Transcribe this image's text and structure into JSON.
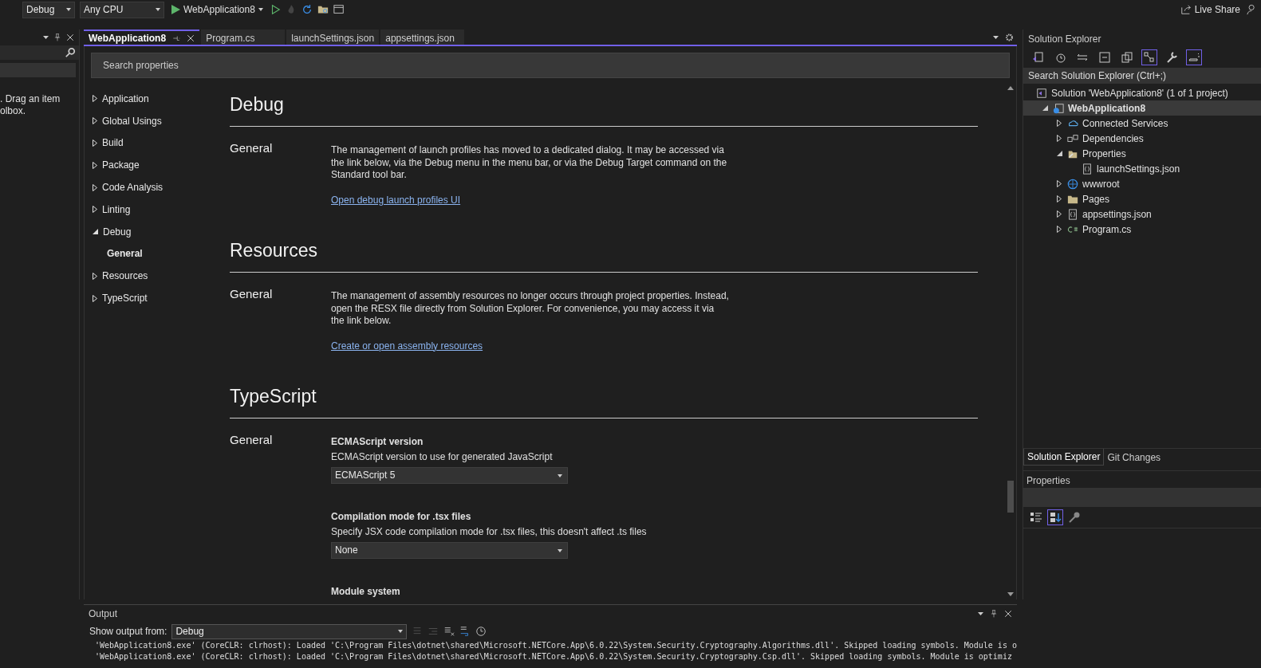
{
  "toolbar": {
    "configuration": "Debug",
    "platform": "Any CPU",
    "start_target": "WebApplication8",
    "live_share": "Live Share"
  },
  "toolbox": {
    "message": ". Drag an item",
    "message_2": "olbox."
  },
  "tabs": [
    {
      "label": "WebApplication8",
      "selected": true
    },
    {
      "label": "Program.cs",
      "selected": false
    },
    {
      "label": "launchSettings.json",
      "selected": false
    },
    {
      "label": "appsettings.json",
      "selected": false
    }
  ],
  "properties_page": {
    "search": {
      "placeholder": "Search properties"
    },
    "nav": [
      {
        "label": "Application",
        "expanded": false,
        "selected": false
      },
      {
        "label": "Global Usings",
        "expanded": false,
        "selected": false
      },
      {
        "label": "Build",
        "expanded": false,
        "selected": false
      },
      {
        "label": "Package",
        "expanded": false,
        "selected": false
      },
      {
        "label": "Code Analysis",
        "expanded": false,
        "selected": false
      },
      {
        "label": "Linting",
        "expanded": false,
        "selected": false
      },
      {
        "label": "Debug",
        "expanded": true,
        "selected": false,
        "children": [
          {
            "label": "General",
            "selected": true
          }
        ]
      },
      {
        "label": "Resources",
        "expanded": false,
        "selected": false
      },
      {
        "label": "TypeScript",
        "expanded": false,
        "selected": false
      }
    ],
    "sections": [
      {
        "title": "Debug",
        "groups": [
          {
            "heading": "General",
            "items": [
              {
                "kind": "text",
                "text": "The management of launch profiles has moved to a dedicated dialog. It may be accessed via the link below, via the Debug menu in the menu bar, or via the Debug Target command on the Standard tool bar.",
                "link": "Open debug launch profiles UI"
              }
            ]
          }
        ]
      },
      {
        "title": "Resources",
        "groups": [
          {
            "heading": "General",
            "items": [
              {
                "kind": "text",
                "text": "The management of assembly resources no longer occurs through project properties. Instead, open the RESX file directly from Solution Explorer. For convenience, you may access it via the link below.",
                "link": "Create or open assembly resources"
              }
            ]
          }
        ]
      },
      {
        "title": "TypeScript",
        "groups": [
          {
            "heading": "General",
            "items": [
              {
                "kind": "dropdown",
                "label": "ECMAScript version",
                "description": "ECMAScript version to use for generated JavaScript",
                "value": "ECMAScript 5"
              },
              {
                "kind": "dropdown",
                "label": "Compilation mode for .tsx files",
                "description": "Specify JSX code compilation mode for .tsx files, this doesn't affect .ts files",
                "value": "None"
              },
              {
                "kind": "heading",
                "label": "Module system"
              }
            ]
          }
        ]
      }
    ]
  },
  "solution_explorer": {
    "title": "Solution Explorer",
    "search": {
      "placeholder": "Search Solution Explorer (Ctrl+;)"
    },
    "tree": [
      {
        "label": "Solution 'WebApplication8' (1 of 1 project)",
        "kind": "solution",
        "selected": false,
        "children": [
          {
            "label": "WebApplication8",
            "kind": "project",
            "expanded": true,
            "selected": true,
            "children": [
              {
                "label": "Connected Services",
                "kind": "services",
                "expanded": false,
                "selected": false
              },
              {
                "label": "Dependencies",
                "kind": "dependencies",
                "expanded": false,
                "selected": false
              },
              {
                "label": "Properties",
                "kind": "properties",
                "expanded": true,
                "selected": false,
                "children": [
                  {
                    "label": "launchSettings.json",
                    "kind": "json",
                    "selected": false
                  }
                ]
              },
              {
                "label": "wwwroot",
                "kind": "web",
                "expanded": false,
                "selected": false
              },
              {
                "label": "Pages",
                "kind": "folder",
                "expanded": false,
                "selected": false
              },
              {
                "label": "appsettings.json",
                "kind": "json",
                "expanded": false,
                "selected": false
              },
              {
                "label": "Program.cs",
                "kind": "csharp",
                "expanded": false,
                "selected": false
              }
            ]
          }
        ]
      }
    ],
    "bottom_tabs": [
      {
        "label": "Solution Explorer",
        "selected": true
      },
      {
        "label": "Git Changes",
        "selected": false
      }
    ]
  },
  "properties_panel": {
    "title": "Properties"
  },
  "output": {
    "title": "Output",
    "source_label": "Show output from:",
    "source": "Debug",
    "lines": [
      "'WebApplication8.exe' (CoreCLR: clrhost): Loaded 'C:\\Program Files\\dotnet\\shared\\Microsoft.NETCore.App\\6.0.22\\System.Security.Cryptography.Algorithms.dll'. Skipped loading symbols. Module is o",
      "'WebApplication8.exe' (CoreCLR: clrhost): Loaded 'C:\\Program Files\\dotnet\\shared\\Microsoft.NETCore.App\\6.0.22\\System.Security.Cryptography.Csp.dll'. Skipped loading symbols. Module is optimiz"
    ]
  }
}
